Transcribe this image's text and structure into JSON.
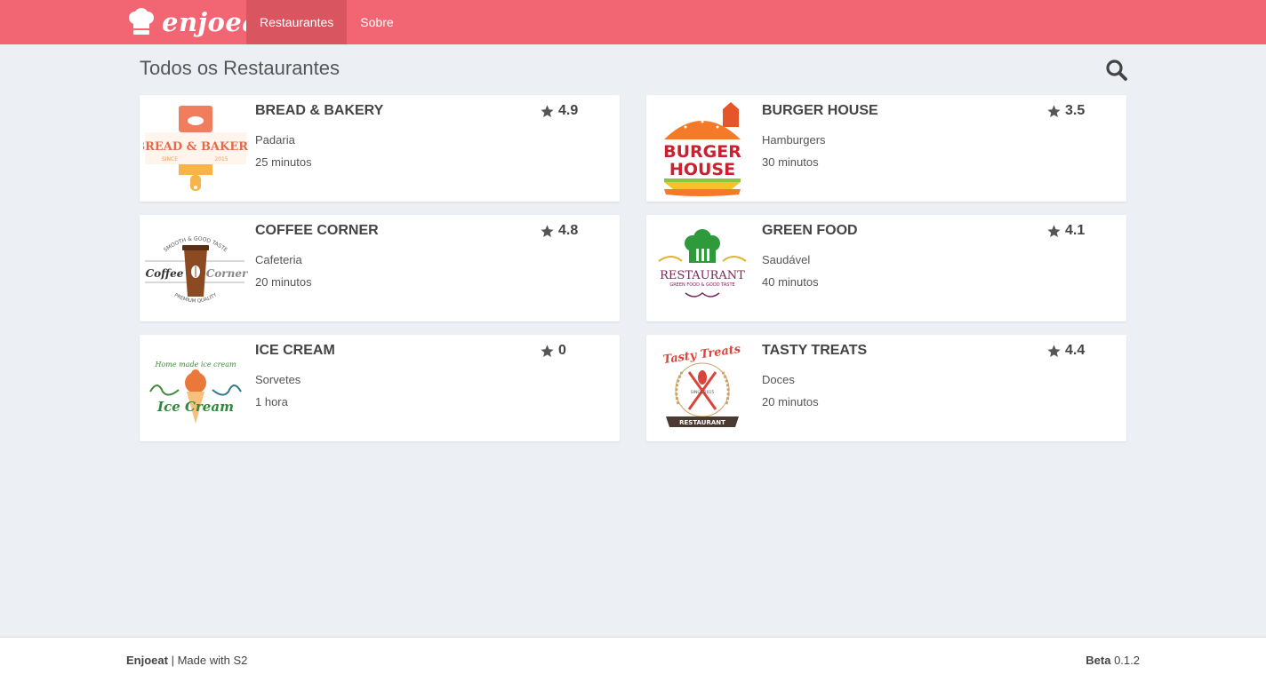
{
  "header": {
    "brand": "enjoeat",
    "nav": [
      {
        "label": "Restaurantes",
        "active": true
      },
      {
        "label": "Sobre",
        "active": false
      }
    ]
  },
  "main": {
    "title": "Todos os Restaurantes",
    "restaurants": [
      {
        "name": "BREAD & BAKERY",
        "category": "Padaria",
        "time": "25 minutos",
        "rating": "4.9",
        "logo_lines": [
          "BREAD & BAKERY",
          "SINCE",
          "2015"
        ]
      },
      {
        "name": "BURGER HOUSE",
        "category": "Hamburgers",
        "time": "30 minutos",
        "rating": "3.5",
        "logo_lines": [
          "BURGER",
          "HOUSE"
        ]
      },
      {
        "name": "COFFEE CORNER",
        "category": "Cafeteria",
        "time": "20 minutos",
        "rating": "4.8",
        "logo_lines": [
          "Coffee",
          "Corner",
          "SMOOTH & GOOD TASTE",
          "PREMIUM QUALITY"
        ]
      },
      {
        "name": "GREEN FOOD",
        "category": "Saudável",
        "time": "40 minutos",
        "rating": "4.1",
        "logo_lines": [
          "RESTAURANT",
          "GREEN FOOD & GOOD TASTE"
        ]
      },
      {
        "name": "ICE CREAM",
        "category": "Sorvetes",
        "time": "1 hora",
        "rating": "0",
        "logo_lines": [
          "Home made ice cream",
          "Ice Cream"
        ]
      },
      {
        "name": "TASTY TREATS",
        "category": "Doces",
        "time": "20 minutos",
        "rating": "4.4",
        "logo_lines": [
          "Tasty Treats",
          "SINCE 2015",
          "RESTAURANT"
        ]
      }
    ]
  },
  "footer": {
    "brand": "Enjoeat",
    "made_with": "| Made with S2",
    "beta_label": "Beta",
    "version": "0.1.2"
  },
  "colors": {
    "header": "#f16672",
    "nav_active": "#d9555f",
    "background": "#ecf0f5"
  }
}
